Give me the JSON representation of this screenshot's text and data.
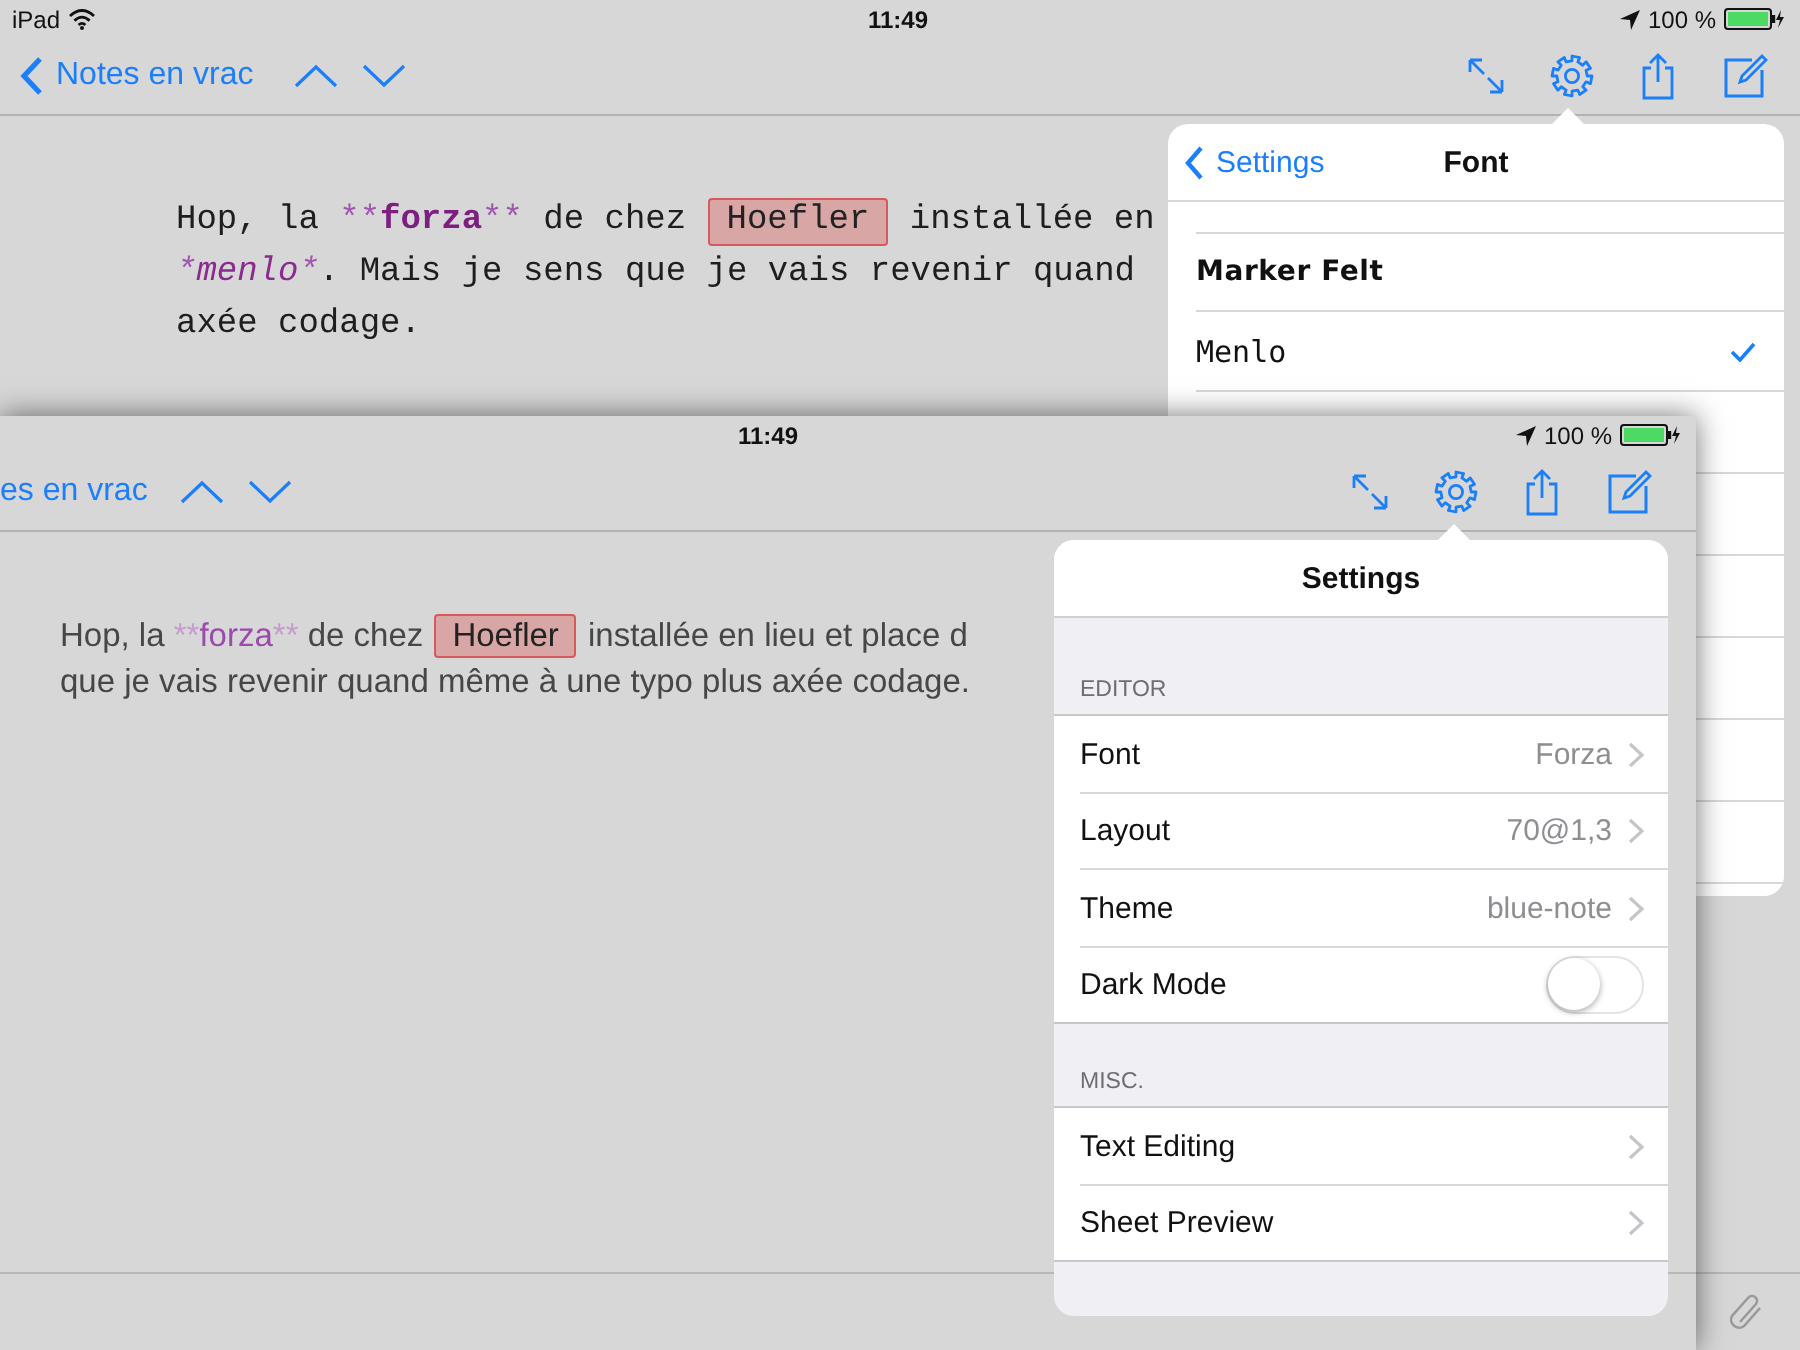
{
  "back_screen": {
    "status_bar": {
      "carrier": "iPad",
      "time": "11:49",
      "battery": "100 %"
    },
    "nav_bar": {
      "back": "Notes en vrac"
    },
    "editor_lines": [
      [
        {
          "kind": "plain",
          "text": "Hop, la "
        },
        {
          "kind": "markup",
          "text": "**"
        },
        {
          "kind": "bold",
          "text": "forza"
        },
        {
          "kind": "markup",
          "text": "**"
        },
        {
          "kind": "plain",
          "text": " de chez "
        },
        {
          "kind": "tag",
          "text": "Hoefler"
        },
        {
          "kind": "plain",
          "text": " installée en"
        }
      ],
      [
        {
          "kind": "markup_italic",
          "text": "*"
        },
        {
          "kind": "italic",
          "text": "menlo"
        },
        {
          "kind": "markup_italic",
          "text": "*"
        },
        {
          "kind": "plain",
          "text": ". Mais je sens que je vais revenir quand"
        }
      ],
      [
        {
          "kind": "plain",
          "text": "axée codage."
        }
      ]
    ],
    "font_popover": {
      "back": "Settings",
      "title": "Font",
      "fonts": [
        {
          "name": "Marker Felt",
          "kind": "handwritten",
          "selected": false
        },
        {
          "name": "Menlo",
          "kind": "monospace",
          "selected": true
        }
      ]
    }
  },
  "front_screen": {
    "status_bar": {
      "time": "11:49",
      "battery": "100 %"
    },
    "nav_bar": {
      "back": "es en vrac"
    },
    "editor_lines": [
      [
        {
          "kind": "plain",
          "text": "Hop, la "
        },
        {
          "kind": "markup",
          "text": "**"
        },
        {
          "kind": "bold",
          "text": "forza"
        },
        {
          "kind": "markup",
          "text": "**"
        },
        {
          "kind": "plain",
          "text": " de chez "
        },
        {
          "kind": "tag",
          "text": "Hoefler"
        },
        {
          "kind": "plain",
          "text": " installée en lieu et place d"
        }
      ],
      [
        {
          "kind": "plain",
          "text": "que je vais revenir quand même à une typo plus axée codage."
        }
      ]
    ],
    "settings_popover": {
      "title": "Settings",
      "sections": [
        {
          "header": "EDITOR",
          "rows": [
            {
              "kind": "link",
              "label": "Font",
              "value": "Forza"
            },
            {
              "kind": "link",
              "label": "Layout",
              "value": "70@1,3"
            },
            {
              "kind": "link",
              "label": "Theme",
              "value": "blue-note"
            },
            {
              "kind": "toggle",
              "label": "Dark Mode",
              "on": false
            }
          ]
        },
        {
          "header": "MISC.",
          "rows": [
            {
              "kind": "link",
              "label": "Text Editing"
            },
            {
              "kind": "link",
              "label": "Sheet Preview"
            }
          ]
        }
      ]
    }
  }
}
